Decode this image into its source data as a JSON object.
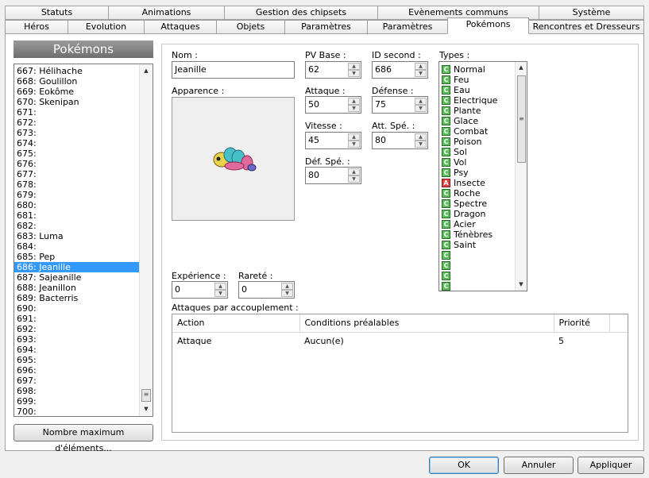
{
  "tabs_row1": [
    "Statuts",
    "Animations",
    "Gestion des chipsets",
    "Evènements communs",
    "Système"
  ],
  "tabs_row2": [
    "Héros",
    "Evolution",
    "Attaques",
    "Objets",
    "Paramètres",
    "Paramètres",
    "Pokémons",
    "Rencontres et Dresseurs"
  ],
  "active_tab": "Pokémons",
  "sidebar": {
    "title": "Pokémons",
    "items": [
      "667: Hélihache",
      "668: Goulillon",
      "669: Eokôme",
      "670: Skenipan",
      "671:",
      "672:",
      "673:",
      "674:",
      "675:",
      "676:",
      "677:",
      "678:",
      "679:",
      "680:",
      "681:",
      "682:",
      "683: Luma",
      "684:",
      "685: Pep",
      "686: Jeanille",
      "687: Sajeanille",
      "688: Jeanillon",
      "689: Bacterris",
      "690:",
      "691:",
      "692:",
      "693:",
      "694:",
      "695:",
      "696:",
      "697:",
      "698:",
      "699:",
      "700:"
    ],
    "selected_index": 19,
    "max_button": "Nombre maximum d'éléments..."
  },
  "form": {
    "name_label": "Nom :",
    "name_value": "Jeanille",
    "appearance_label": "Apparence :",
    "pv_label": "PV Base :",
    "pv_value": "62",
    "id2_label": "ID second :",
    "id2_value": "686",
    "atk_label": "Attaque :",
    "atk_value": "50",
    "def_label": "Défense :",
    "def_value": "75",
    "spd_label": "Vitesse :",
    "spd_value": "45",
    "spatk_label": "Att. Spé. :",
    "spatk_value": "80",
    "spdef_label": "Déf. Spé. :",
    "spdef_value": "80",
    "exp_label": "Expérience :",
    "exp_value": "0",
    "rarity_label": "Rareté :",
    "rarity_value": "0"
  },
  "types": {
    "label": "Types :",
    "items": [
      {
        "name": "Normal",
        "mark": "C"
      },
      {
        "name": "Feu",
        "mark": "C"
      },
      {
        "name": "Eau",
        "mark": "C"
      },
      {
        "name": "Electrique",
        "mark": "C"
      },
      {
        "name": "Plante",
        "mark": "C"
      },
      {
        "name": "Glace",
        "mark": "C"
      },
      {
        "name": "Combat",
        "mark": "C"
      },
      {
        "name": "Poison",
        "mark": "C"
      },
      {
        "name": "Sol",
        "mark": "C"
      },
      {
        "name": "Vol",
        "mark": "C"
      },
      {
        "name": "Psy",
        "mark": "C"
      },
      {
        "name": "Insecte",
        "mark": "A"
      },
      {
        "name": "Roche",
        "mark": "C"
      },
      {
        "name": "Spectre",
        "mark": "C"
      },
      {
        "name": "Dragon",
        "mark": "C"
      },
      {
        "name": "Acier",
        "mark": "C"
      },
      {
        "name": "Ténèbres",
        "mark": "C"
      },
      {
        "name": "Saint",
        "mark": "C"
      },
      {
        "name": "",
        "mark": "C"
      },
      {
        "name": "",
        "mark": "C"
      },
      {
        "name": "",
        "mark": "C"
      },
      {
        "name": "",
        "mark": "C"
      }
    ]
  },
  "attacks": {
    "label": "Attaques par accouplement :",
    "columns": [
      "Action",
      "Conditions préalables",
      "Priorité"
    ],
    "rows": [
      [
        "Attaque",
        "Aucun(e)",
        "5"
      ]
    ]
  },
  "buttons": {
    "ok": "OK",
    "cancel": "Annuler",
    "apply": "Appliquer"
  },
  "colors": {
    "selection": "#3399ff",
    "type_checkbox": "#5cbf5c",
    "type_checked": "#e04040"
  }
}
